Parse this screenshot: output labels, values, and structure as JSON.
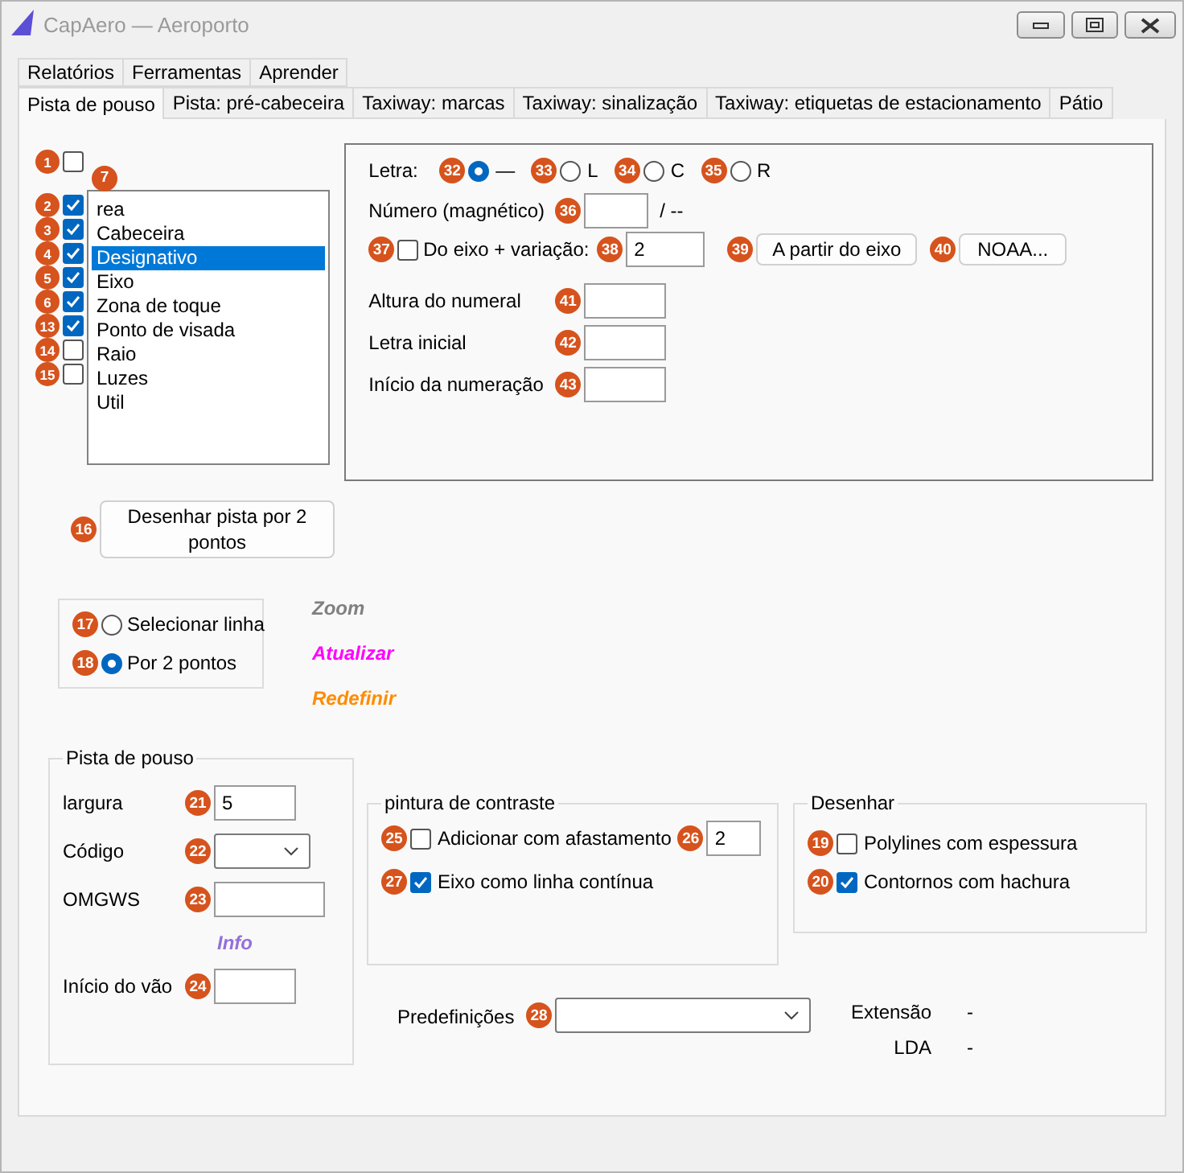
{
  "window": {
    "title": "CapAero — Aeroporto"
  },
  "tab_rows": [
    {
      "tabs": [
        {
          "label": "Relatórios",
          "selected": false
        },
        {
          "label": "Ferramentas",
          "selected": false
        },
        {
          "label": "Aprender",
          "selected": false
        }
      ]
    },
    {
      "tabs": [
        {
          "label": "Pista de pouso",
          "selected": true
        },
        {
          "label": "Pista: pré-cabeceira",
          "selected": false
        },
        {
          "label": "Taxiway: marcas",
          "selected": false
        },
        {
          "label": "Taxiway: sinalização",
          "selected": false
        },
        {
          "label": "Taxiway: etiquetas de estacionamento",
          "selected": false
        },
        {
          "label": "Pátio",
          "selected": false
        }
      ]
    }
  ],
  "show_checkbox": {
    "badge": "1",
    "checked": false
  },
  "layers": [
    {
      "badge": "2",
      "checked": true
    },
    {
      "badge": "3",
      "checked": true
    },
    {
      "badge": "4",
      "checked": true
    },
    {
      "badge": "5",
      "checked": true
    },
    {
      "badge": "6",
      "checked": true
    },
    {
      "badge": "13",
      "checked": true
    },
    {
      "badge": "14",
      "checked": false
    },
    {
      "badge": "15",
      "checked": false
    }
  ],
  "layer_list": {
    "badge": "7",
    "items": [
      {
        "label": "rea",
        "selected": false
      },
      {
        "label": "Cabeceira",
        "selected": false
      },
      {
        "label": "Designativo",
        "selected": true
      },
      {
        "label": "Eixo",
        "selected": false
      },
      {
        "label": "Zona de toque",
        "selected": false
      },
      {
        "label": "Ponto de visada",
        "selected": false
      },
      {
        "label": "Raio",
        "selected": false
      },
      {
        "label": "Luzes",
        "selected": false
      },
      {
        "label": "Util",
        "selected": false
      }
    ]
  },
  "letter": {
    "label": "Letra:",
    "options": [
      {
        "badge": "32",
        "label": "—",
        "selected": true
      },
      {
        "badge": "33",
        "label": "L",
        "selected": false
      },
      {
        "badge": "34",
        "label": "C",
        "selected": false
      },
      {
        "badge": "35",
        "label": "R",
        "selected": false
      }
    ]
  },
  "number": {
    "label": "Número (magnético)",
    "badge": "36",
    "suffix": "/ --"
  },
  "axis_variation": {
    "badge": "37",
    "label": "Do eixo + variação:",
    "checked": false,
    "field": {
      "badge": "38",
      "value": "2"
    }
  },
  "buttons": [
    {
      "badge": "39",
      "label": "A partir do eixo"
    },
    {
      "badge": "40",
      "label": "NOAA..."
    }
  ],
  "numeral_fields": [
    {
      "label": "Altura do numeral",
      "badge": "41"
    },
    {
      "label": "Letra inicial",
      "badge": "42"
    },
    {
      "label": "Início da numeração",
      "badge": "43"
    }
  ],
  "draw_button": {
    "badge": "16",
    "label": "Desenhar pista por 2 pontos"
  },
  "mode": [
    {
      "badge": "17",
      "label": "Selecionar linha",
      "selected": false
    },
    {
      "badge": "18",
      "label": "Por 2 pontos",
      "selected": true
    }
  ],
  "links": [
    {
      "label": "Zoom",
      "color": "#808080"
    },
    {
      "label": "Atualizar",
      "color": "#ff00ff"
    },
    {
      "label": "Redefinir",
      "color": "#ff8c00"
    }
  ],
  "runway_group": {
    "title": "Pista de pouso",
    "rows": [
      {
        "kind": "field",
        "label": "largura",
        "badge": "21",
        "value": "5"
      },
      {
        "kind": "combo",
        "label": "Código",
        "badge": "22"
      },
      {
        "kind": "field",
        "label": "OMGWS",
        "badge": "23",
        "wide": true
      },
      {
        "kind": "link",
        "label": "Info",
        "color": "#9370db"
      },
      {
        "kind": "field",
        "label": "Início do vão",
        "badge": "24"
      }
    ]
  },
  "contrast_group": {
    "title": "pintura de contraste",
    "offset": {
      "badge": "25",
      "label": "Adicionar com afastamento",
      "checked": false,
      "field": {
        "badge": "26",
        "value": "2"
      }
    },
    "continuous": {
      "badge": "27",
      "label": "Eixo como linha contínua",
      "checked": true
    }
  },
  "draw_group": {
    "title": "Desenhar",
    "options": [
      {
        "badge": "19",
        "label": "Polylines com espessura",
        "checked": false
      },
      {
        "badge": "20",
        "label": "Contornos com hachura",
        "checked": true
      }
    ]
  },
  "presets": {
    "label": "Predefinições",
    "badge": "28"
  },
  "stats": [
    {
      "label": "Extensão",
      "value": "-"
    },
    {
      "label": "LDA",
      "value": "-"
    }
  ]
}
